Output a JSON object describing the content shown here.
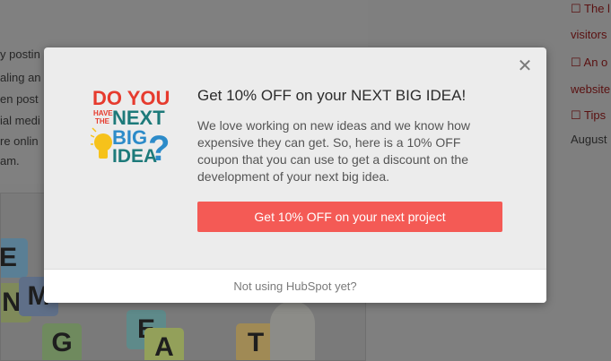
{
  "background": {
    "article_lines": [
      "y postin",
      "aling an",
      "en post",
      "ial medi",
      "re onlin",
      "am."
    ],
    "sidebar_lines": [
      {
        "text": "☐ The l",
        "link": true
      },
      {
        "text": "visitors",
        "link": true
      },
      {
        "text": "☐ An o",
        "link": true
      },
      {
        "text": "website",
        "link": true
      },
      {
        "text": "☐ Tips",
        "link": true
      },
      {
        "text": "August",
        "link": false
      }
    ],
    "cube_letters": [
      "E",
      "M",
      "G",
      "M",
      "E",
      "T",
      "A",
      "N"
    ]
  },
  "modal": {
    "close_symbol": "✕",
    "logo": {
      "line1": "DO YOU",
      "line2a": "HAVE",
      "line2b": "THE",
      "line2c": "NEXT",
      "line3": "BIG",
      "line4": "IDEA",
      "qmark": "?"
    },
    "headline": "Get 10% OFF on your NEXT BIG IDEA!",
    "body": "We love working on new ideas and we know how expensive they can get. So, here is a 10% OFF coupon that you can use to get a discount on the development of your next big idea.",
    "cta_label": "Get 10% OFF on your next project",
    "footer_link": "Not using HubSpot yet?"
  },
  "colors": {
    "cta": "#f45a55",
    "logo_red": "#e63b2e",
    "logo_teal": "#1d7a7a",
    "logo_yellow": "#f6c21b",
    "logo_blue": "#2c8bc9"
  }
}
